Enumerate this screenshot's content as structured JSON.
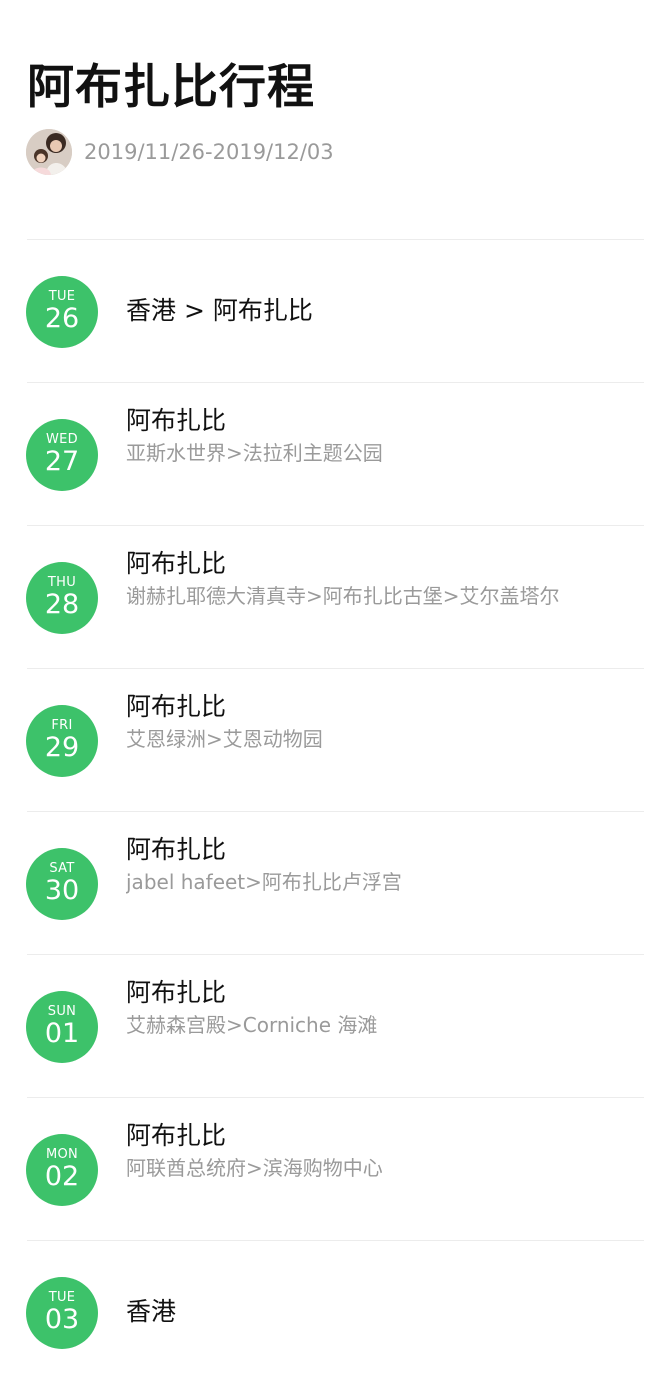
{
  "trip": {
    "title": "阿布扎比行程",
    "date_range": "2019/11/26-2019/12/03",
    "accent_color": "#3dc26a",
    "avatar_icon": "user-avatar-photo"
  },
  "days": [
    {
      "dow": "TUE",
      "dom": "26",
      "title": "香港 > 阿布扎比",
      "subtitle": ""
    },
    {
      "dow": "WED",
      "dom": "27",
      "title": "阿布扎比",
      "subtitle": "亚斯水世界>法拉利主题公园"
    },
    {
      "dow": "THU",
      "dom": "28",
      "title": "阿布扎比",
      "subtitle": "谢赫扎耶德大清真寺>阿布扎比古堡>艾尔盖塔尔"
    },
    {
      "dow": "FRI",
      "dom": "29",
      "title": "阿布扎比",
      "subtitle": "艾恩绿洲>艾恩动物园"
    },
    {
      "dow": "SAT",
      "dom": "30",
      "title": "阿布扎比",
      "subtitle": "jabel hafeet>阿布扎比卢浮宫"
    },
    {
      "dow": "SUN",
      "dom": "01",
      "title": "阿布扎比",
      "subtitle": "艾赫森宫殿>Corniche 海滩"
    },
    {
      "dow": "MON",
      "dom": "02",
      "title": "阿布扎比",
      "subtitle": "阿联酋总统府>滨海购物中心"
    },
    {
      "dow": "TUE",
      "dom": "03",
      "title": "香港",
      "subtitle": ""
    }
  ]
}
